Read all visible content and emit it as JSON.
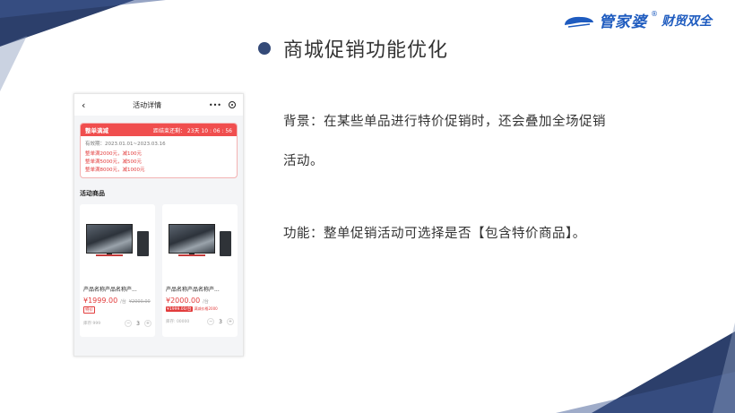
{
  "logo": {
    "brand": "管家婆",
    "reg": "®",
    "slogan": "财贸双全"
  },
  "title": "商城促销功能优化",
  "phone": {
    "back_icon": "chevron-left-icon",
    "page_title": "活动详情",
    "more": "•••",
    "promo": {
      "name": "整单满减",
      "countdown_label": "距结束还剩：",
      "countdown": "23天 10 : 06 : 56",
      "period": "有效期：2023.01.01~2023.03.16",
      "rules": [
        "整单满2000元，减100元",
        "整单满5000元，减500元",
        "整单满8000元，减1000元"
      ]
    },
    "section_title": "活动商品",
    "products": [
      {
        "name": "产品名称产品名称产...",
        "price": "¥1999.00",
        "unit": "/台",
        "old_price": "¥2000.00",
        "tag": "特价",
        "stock": "库存:999",
        "qty": "3"
      },
      {
        "name": "产品名称产品名称产...",
        "price": "¥2000.00",
        "unit": "/台",
        "tag_solid": "¥1999.00/台",
        "tag_note": "满减价格2000",
        "stock": "库存: 00000",
        "qty": "3"
      }
    ]
  },
  "background_text_line1": "背景：在某些单品进行特价促销时，还会叠加全场促销",
  "background_text_line2": "活动。",
  "function_text": "功能：整单促销活动可选择是否【包含特价商品】。",
  "colors": {
    "accent_red": "#f04e4e",
    "brand_blue": "#1e5bbf",
    "deco_navy": "#2c3f6b"
  }
}
